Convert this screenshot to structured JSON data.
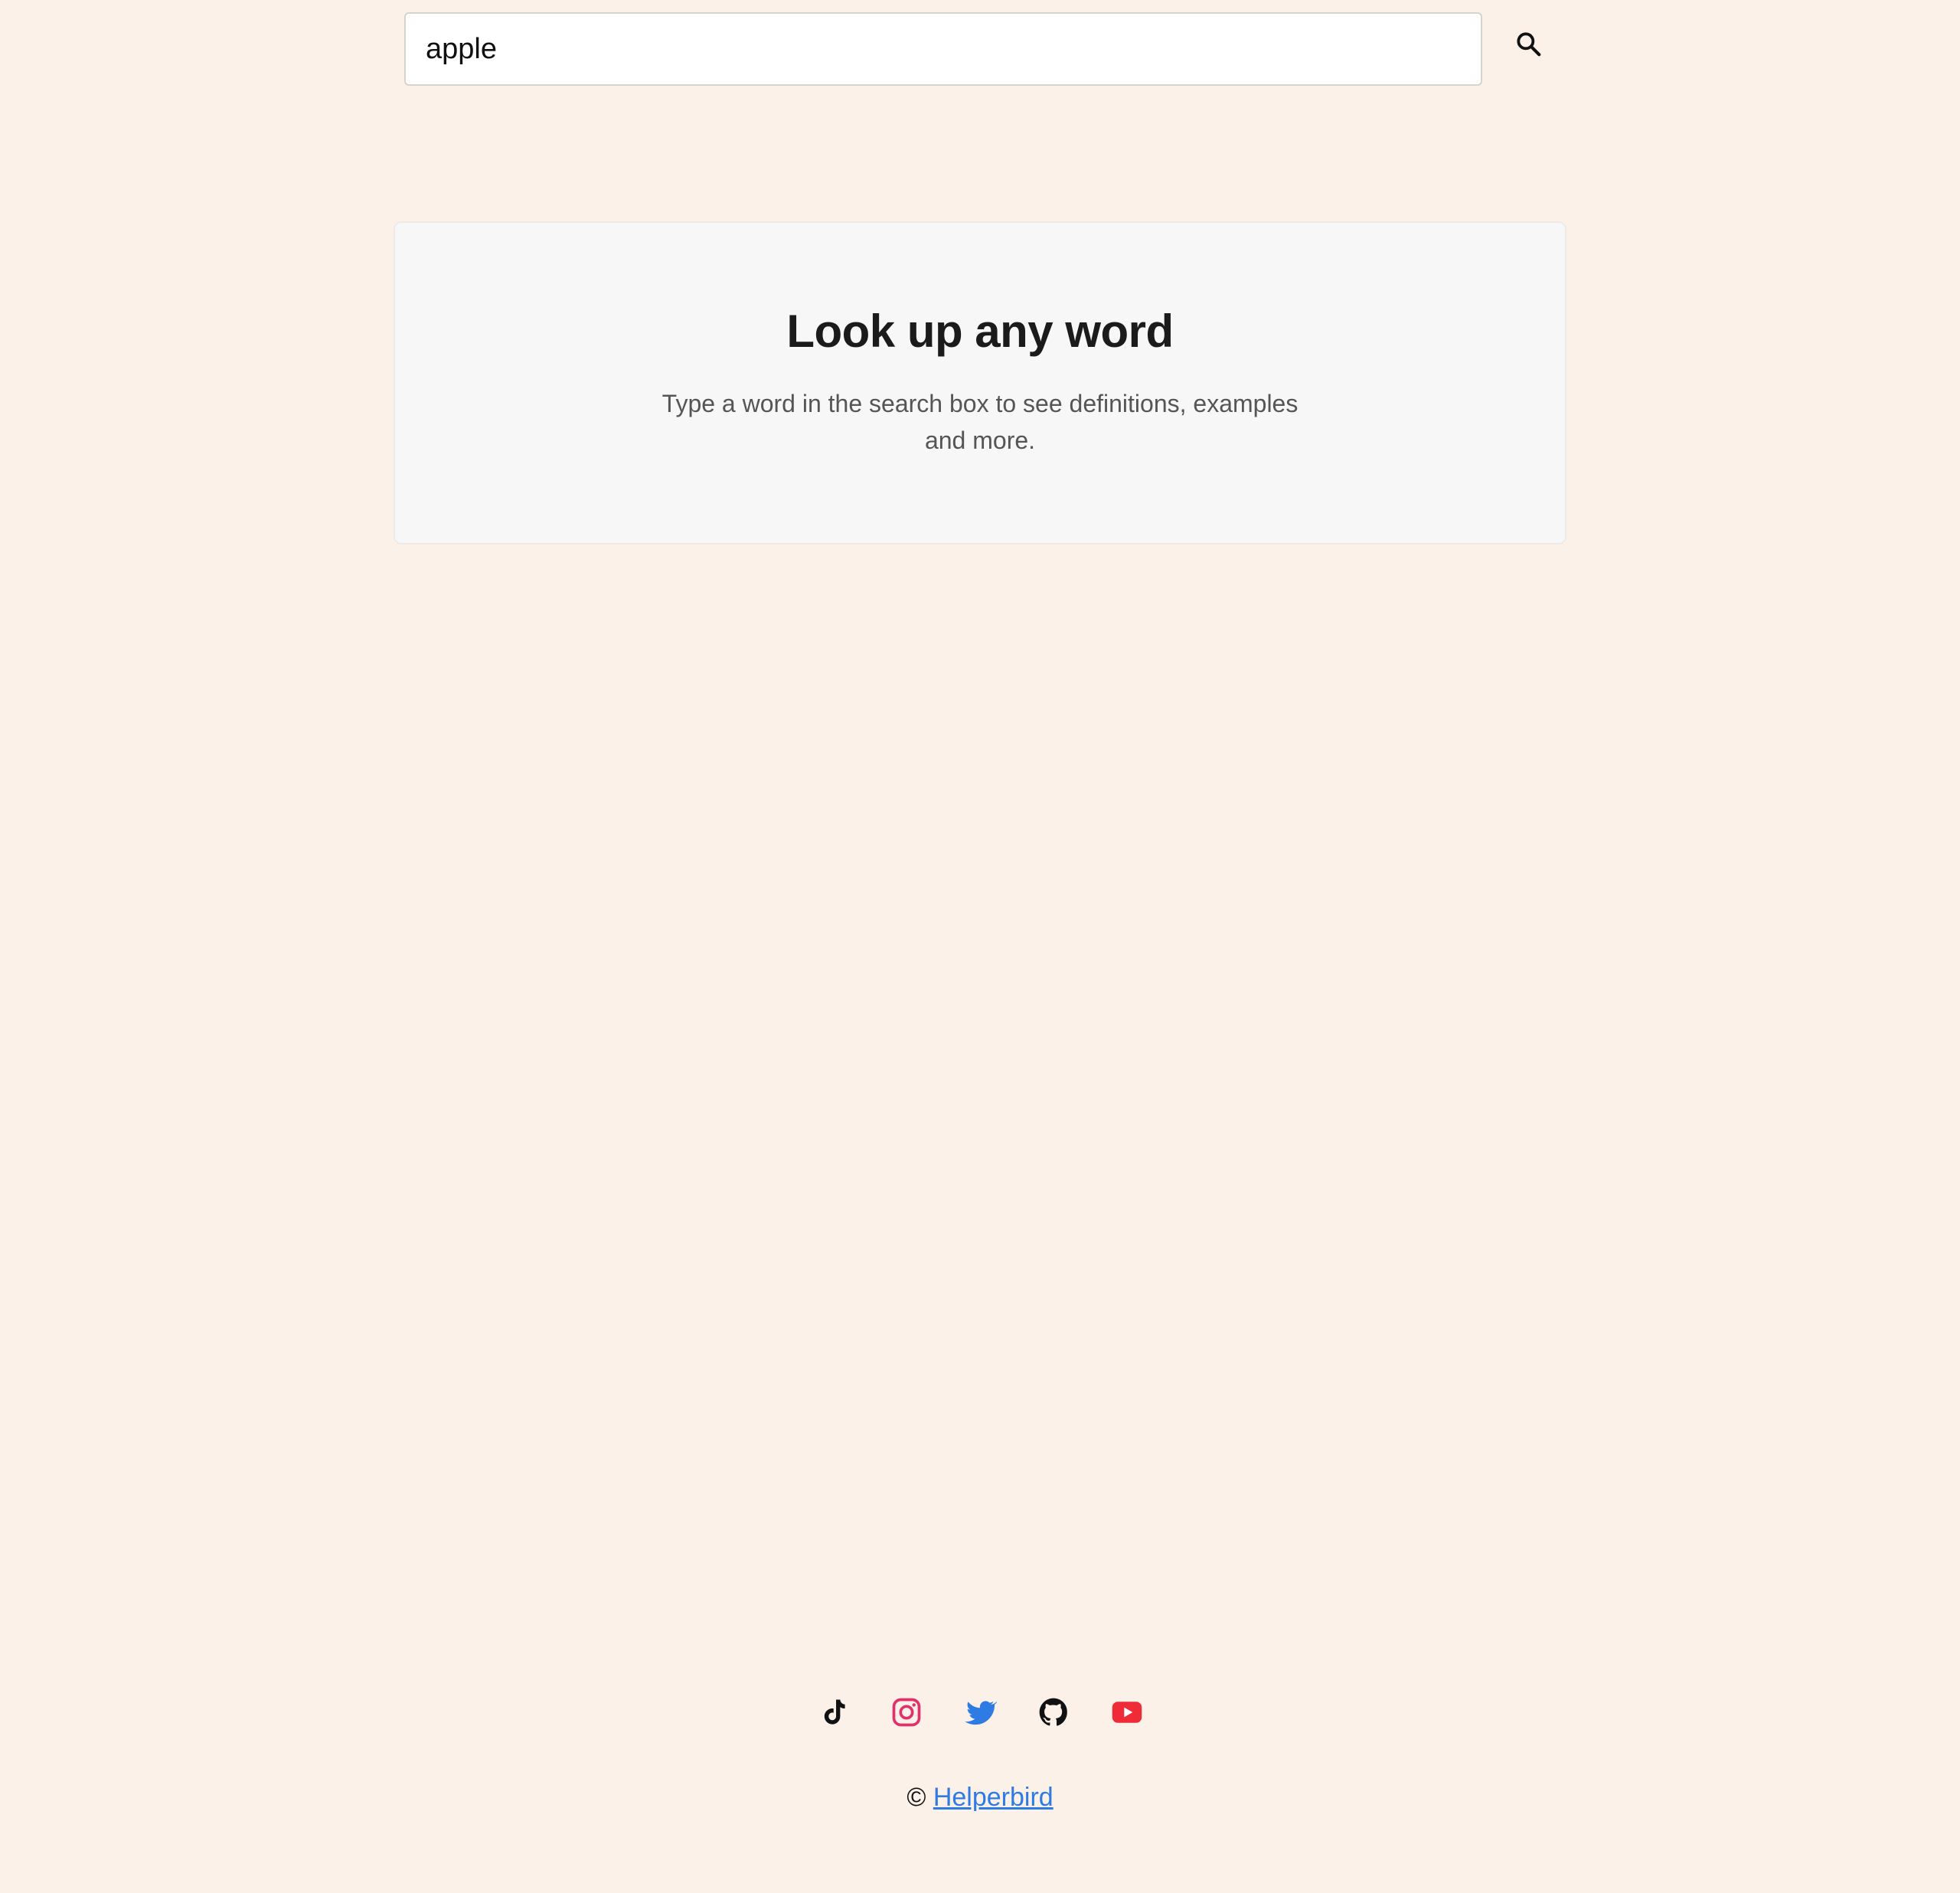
{
  "search": {
    "value": "apple",
    "placeholder": "",
    "button_icon": "search-icon"
  },
  "empty_state": {
    "title": "Look up any word",
    "subtitle": "Type a word in the search box to see definitions, examples and more."
  },
  "footer": {
    "social": [
      {
        "icon": "tiktok-icon",
        "color": "#111111"
      },
      {
        "icon": "instagram-icon",
        "color": "#E1306C"
      },
      {
        "icon": "twitter-icon",
        "color": "#2F7BE4"
      },
      {
        "icon": "github-icon",
        "color": "#111111"
      },
      {
        "icon": "youtube-icon",
        "color": "#EE2B37"
      }
    ],
    "copyright_symbol": "©",
    "brand_link": "Helperbird"
  },
  "colors": {
    "background": "#FBF1E8",
    "card": "#F7F7F7",
    "link": "#2F7BE4"
  }
}
